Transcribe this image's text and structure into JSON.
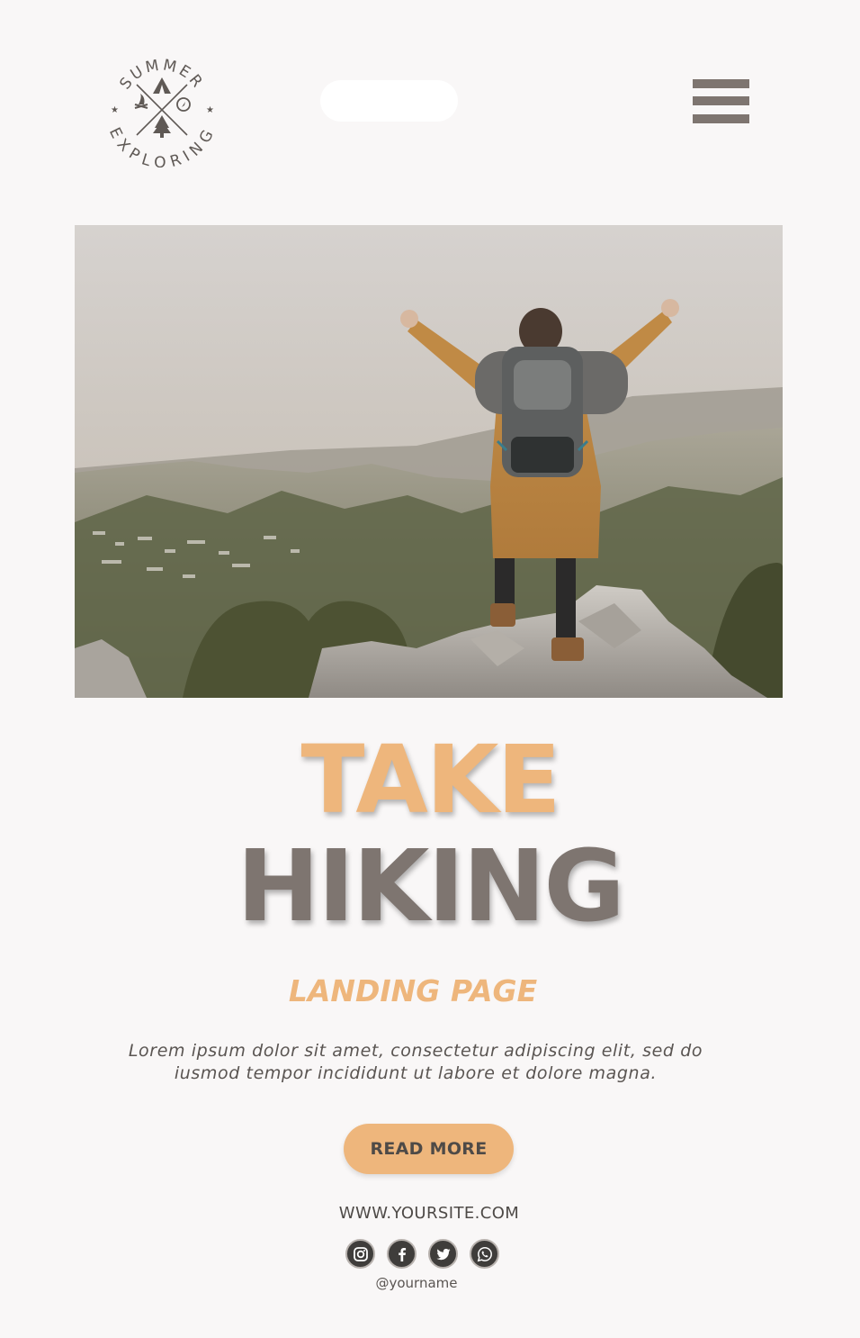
{
  "header": {
    "logo": {
      "top_text": "SUMMER",
      "bottom_text": "EXPLORING",
      "icon": "camping-badge-icon"
    },
    "search": {
      "placeholder": ""
    },
    "menu_icon": "hamburger-menu-icon"
  },
  "hero": {
    "image": "hiker-on-mountain-photo"
  },
  "headline": {
    "line1": "TAKE",
    "line2": "HIKING"
  },
  "subtitle": "LANDING PAGE",
  "body": {
    "line1": "Lorem ipsum dolor sit amet, consectetur adipiscing elit, sed do",
    "line2": "iusmod tempor incididunt ut labore et dolore magna."
  },
  "cta": {
    "label": "READ MORE"
  },
  "footer": {
    "website": "WWW.YOURSITE.COM",
    "socials": [
      "instagram-icon",
      "facebook-icon",
      "twitter-icon",
      "whatsapp-icon"
    ],
    "handle": "@yourname"
  },
  "colors": {
    "background": "#f9f7f7",
    "accent": "#eeb67c",
    "taupe": "#7e7570",
    "text_dark": "#4e4a47",
    "social_bg": "#3f3d3b"
  }
}
